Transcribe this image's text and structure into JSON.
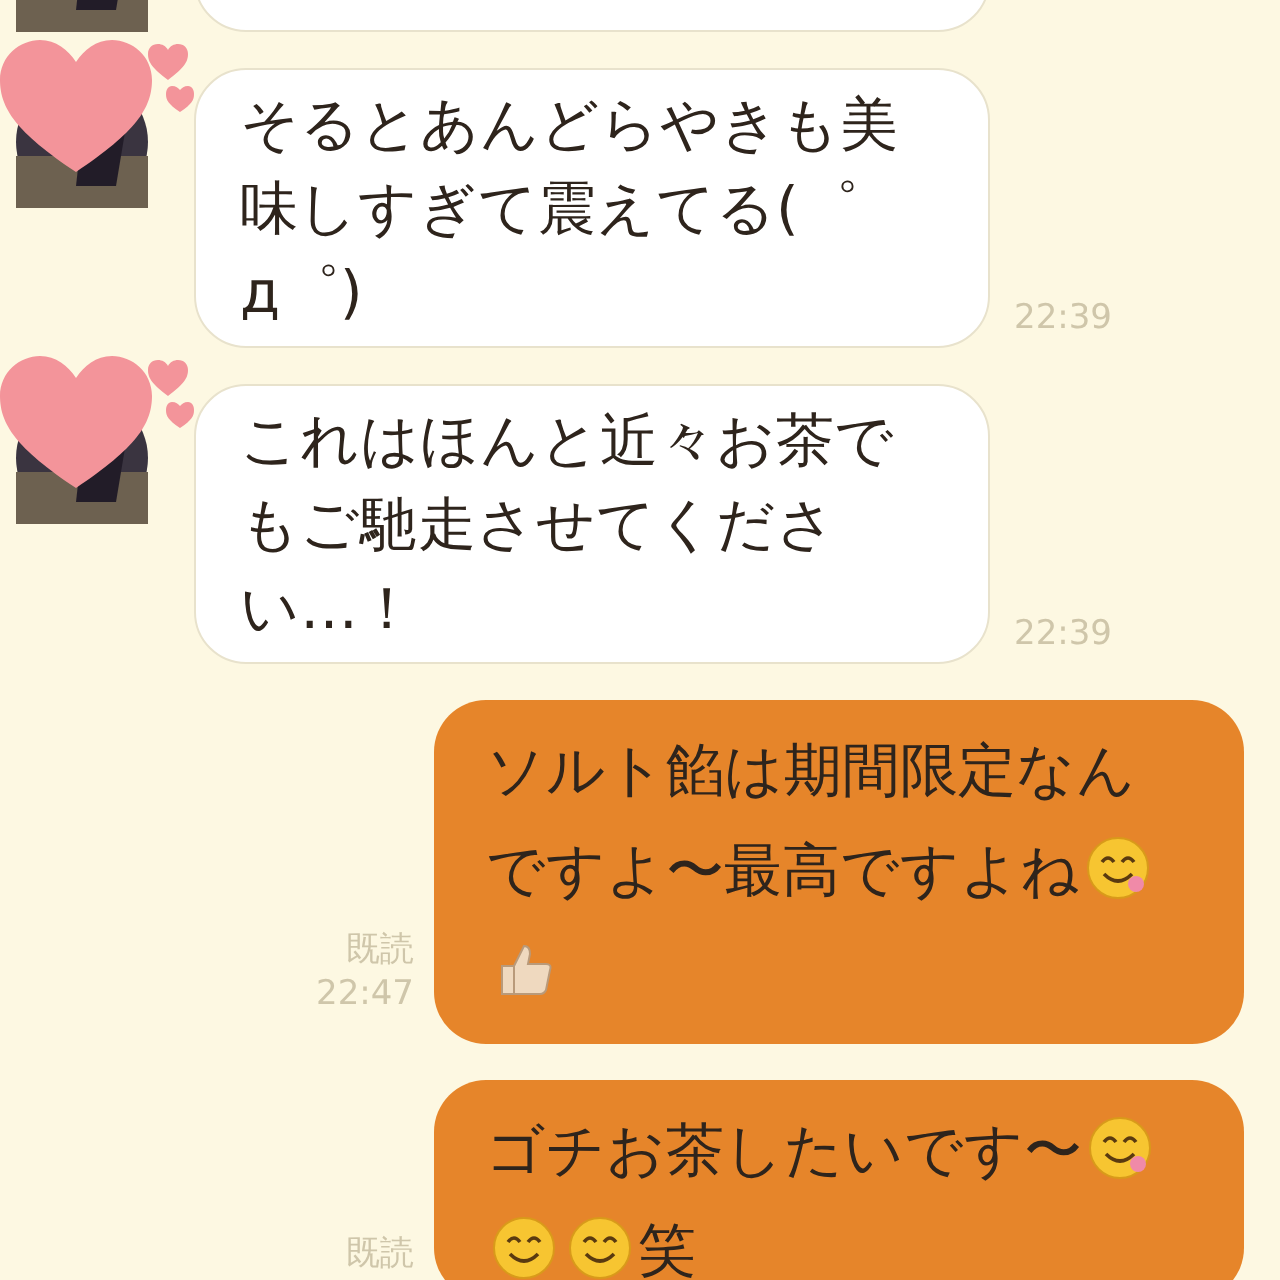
{
  "messages": [
    {
      "kind": "received-cut"
    },
    {
      "kind": "received",
      "parts": [
        {
          "kind": "text",
          "text": "そるとあんどらやきも美味しすぎて震えてる(゜д゜)"
        }
      ],
      "time": "22:39"
    },
    {
      "kind": "received",
      "parts": [
        {
          "kind": "text",
          "text": "これはほんと近々お茶でもご馳走させてください…！"
        }
      ],
      "time": "22:39"
    },
    {
      "kind": "sent",
      "parts": [
        {
          "kind": "text",
          "text": "ソルト餡は期間限定なん"
        },
        {
          "kind": "line-break"
        },
        {
          "kind": "text",
          "text": "ですよ〜最高ですよね"
        },
        {
          "kind": "savoring-face"
        },
        {
          "kind": "line-break"
        },
        {
          "kind": "thumbs-up"
        }
      ],
      "read": "既読",
      "time": "22:47"
    },
    {
      "kind": "sent",
      "parts": [
        {
          "kind": "text",
          "text": "ゴチお茶したいです〜"
        },
        {
          "kind": "savoring-face"
        },
        {
          "kind": "line-break"
        },
        {
          "kind": "smiling-face"
        },
        {
          "kind": "smiling-face"
        },
        {
          "kind": "text",
          "text": "笑"
        }
      ],
      "read": "既読"
    }
  ]
}
